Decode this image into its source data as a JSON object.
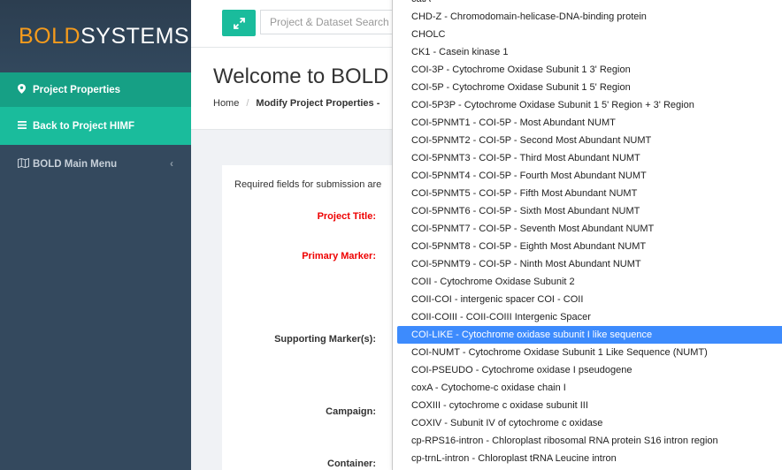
{
  "sidebar": {
    "logo_bold": "BOLD",
    "logo_systems": "SYSTEMS",
    "items": [
      {
        "label": "Project Properties"
      },
      {
        "label": "Back to Project HIMF"
      },
      {
        "label": "BOLD Main Menu"
      }
    ]
  },
  "topbar": {
    "search_placeholder": "Project & Dataset Search"
  },
  "page": {
    "title": "Welcome to BOLD",
    "breadcrumb_home": "Home",
    "breadcrumb_current": "Modify Project Properties -"
  },
  "form": {
    "required_note": "Required fields for submission are",
    "labels": {
      "project_title": "Project Title:",
      "primary_marker": "Primary Marker:",
      "supporting_markers": "Supporting Marker(s):",
      "campaign": "Campaign:",
      "container": "Container:"
    }
  },
  "dropdown": {
    "options": [
      "catA",
      "CHD-Z - Chromodomain-helicase-DNA-binding protein",
      "CHOLC",
      "CK1 - Casein kinase 1",
      "COI-3P - Cytochrome Oxidase Subunit 1 3' Region",
      "COI-5P - Cytochrome Oxidase Subunit 1 5' Region",
      "COI-5P3P - Cytochrome Oxidase Subunit 1 5' Region + 3' Region",
      "COI-5PNMT1 - COI-5P - Most Abundant NUMT",
      "COI-5PNMT2 - COI-5P - Second Most Abundant NUMT",
      "COI-5PNMT3 - COI-5P - Third Most Abundant NUMT",
      "COI-5PNMT4 - COI-5P - Fourth Most Abundant NUMT",
      "COI-5PNMT5 - COI-5P - Fifth Most Abundant NUMT",
      "COI-5PNMT6 - COI-5P - Sixth Most Abundant NUMT",
      "COI-5PNMT7 - COI-5P - Seventh Most Abundant NUMT",
      "COI-5PNMT8 - COI-5P - Eighth Most Abundant NUMT",
      "COI-5PNMT9 - COI-5P - Ninth Most Abundant NUMT",
      "COII - Cytochrome Oxidase Subunit 2",
      "COII-COI - intergenic spacer COI - COII",
      "COII-COIII - COII-COIII Intergenic Spacer",
      "COI-LIKE - Cytochrome oxidase subunit I like sequence",
      "COI-NUMT - Cytochrome Oxidase Subunit 1 Like Sequence (NUMT)",
      "COI-PSEUDO - Cytochrome oxidase I pseudogene",
      "coxA - Cytochome-c oxidase chain I",
      "COXIII - cytochrome c oxidase subunit III",
      "COXIV - Subunit IV of cytochrome c oxidase",
      "cp-RPS16-intron - Chloroplast ribosomal RNA protein S16 intron region",
      "cp-trnL-intron - Chloroplast tRNA Leucine intron"
    ],
    "selected_index": 19
  }
}
